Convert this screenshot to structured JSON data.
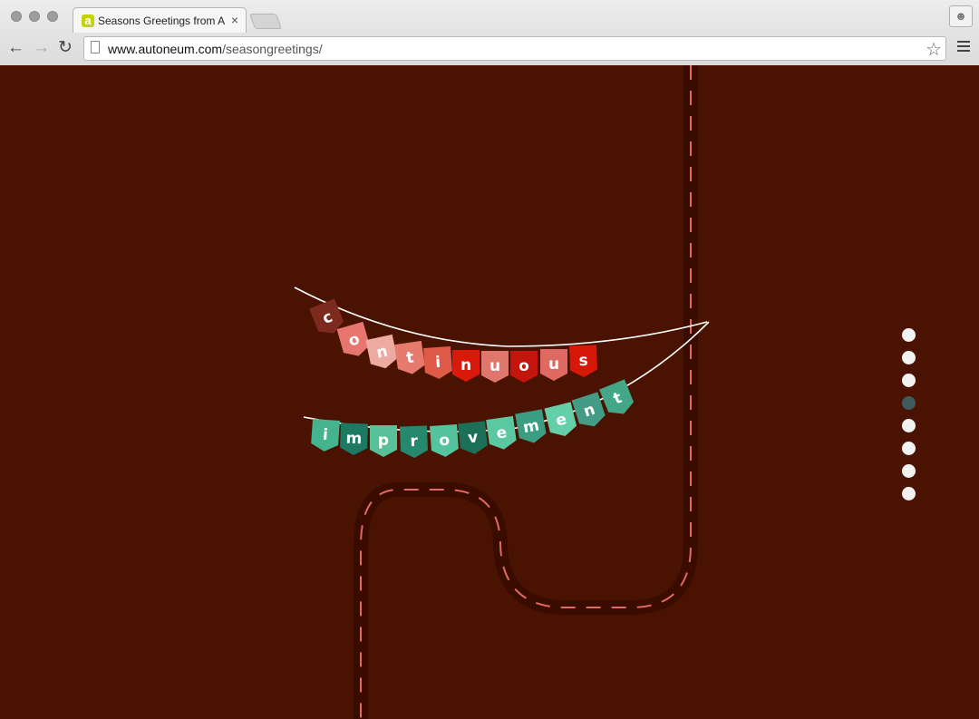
{
  "browser": {
    "tab_title": "Seasons Greetings from Autoneum",
    "tab_close": "×",
    "url_host": "www.autoneum.com",
    "url_path": "/seasongreetings/",
    "favicon_letter": "a"
  },
  "banner_top": {
    "text": "continuous",
    "letters": [
      "c",
      "o",
      "n",
      "t",
      "i",
      "n",
      "u",
      "o",
      "u",
      "s"
    ],
    "colors": [
      "#7d2a1e",
      "#e9766e",
      "#eeaaa0",
      "#e67a6c",
      "#e05a4a",
      "#d91a0a",
      "#e0776d",
      "#c4150c",
      "#df6a62",
      "#d61808"
    ]
  },
  "banner_bottom": {
    "text": "improvement",
    "letters": [
      "i",
      "m",
      "p",
      "r",
      "o",
      "v",
      "e",
      "m",
      "e",
      "n",
      "t"
    ],
    "colors": [
      "#46b38f",
      "#1c7a62",
      "#59c19a",
      "#26896e",
      "#55c39d",
      "#1c7058",
      "#5ac9a2",
      "#3b9e82",
      "#65cfaa",
      "#459c86",
      "#43a787"
    ]
  },
  "road": {
    "color": "#3a0c00",
    "dash_color": "#e06a5e"
  },
  "pagination": {
    "count": 8,
    "active_index": 3
  }
}
